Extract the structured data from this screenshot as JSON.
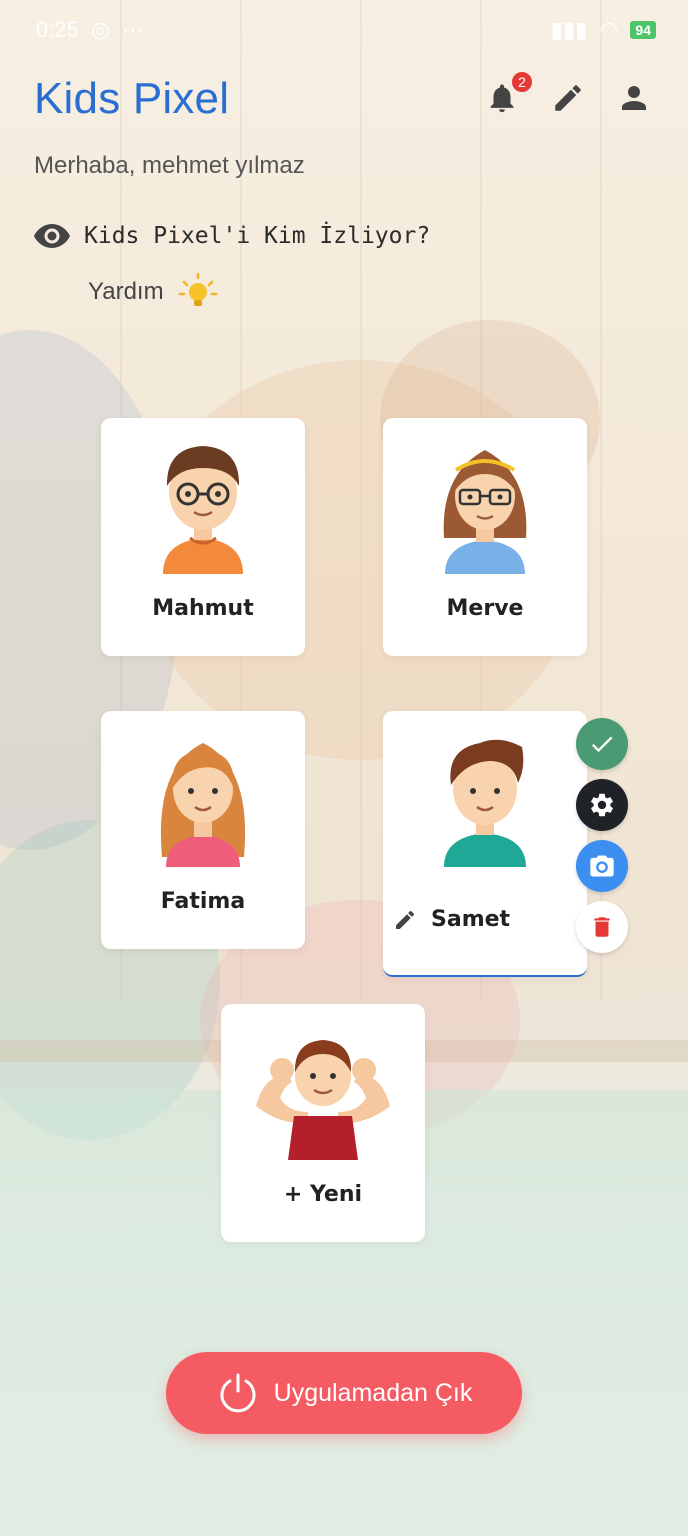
{
  "status_bar": {
    "time": "0:25",
    "battery": "94"
  },
  "header": {
    "title": "Kids Pixel",
    "notification_count": "2",
    "greeting": "Merhaba, mehmet yılmaz",
    "who_watching": "Kids Pixel'i Kim İzliyor?",
    "help_label": "Yardım"
  },
  "profiles": [
    {
      "name": "Mahmut"
    },
    {
      "name": "Merve"
    },
    {
      "name": "Fatima"
    },
    {
      "name": "Samet"
    }
  ],
  "new_profile": {
    "label": "+ Yeni"
  },
  "exit": {
    "label": "Uygulamadan Çık"
  },
  "colors": {
    "brand": "#2a6ed3",
    "exit": "#f45b62",
    "confirm": "#4a9b74",
    "settings": "#1f2328",
    "camera": "#3a8ff0",
    "delete": "#e53935"
  }
}
